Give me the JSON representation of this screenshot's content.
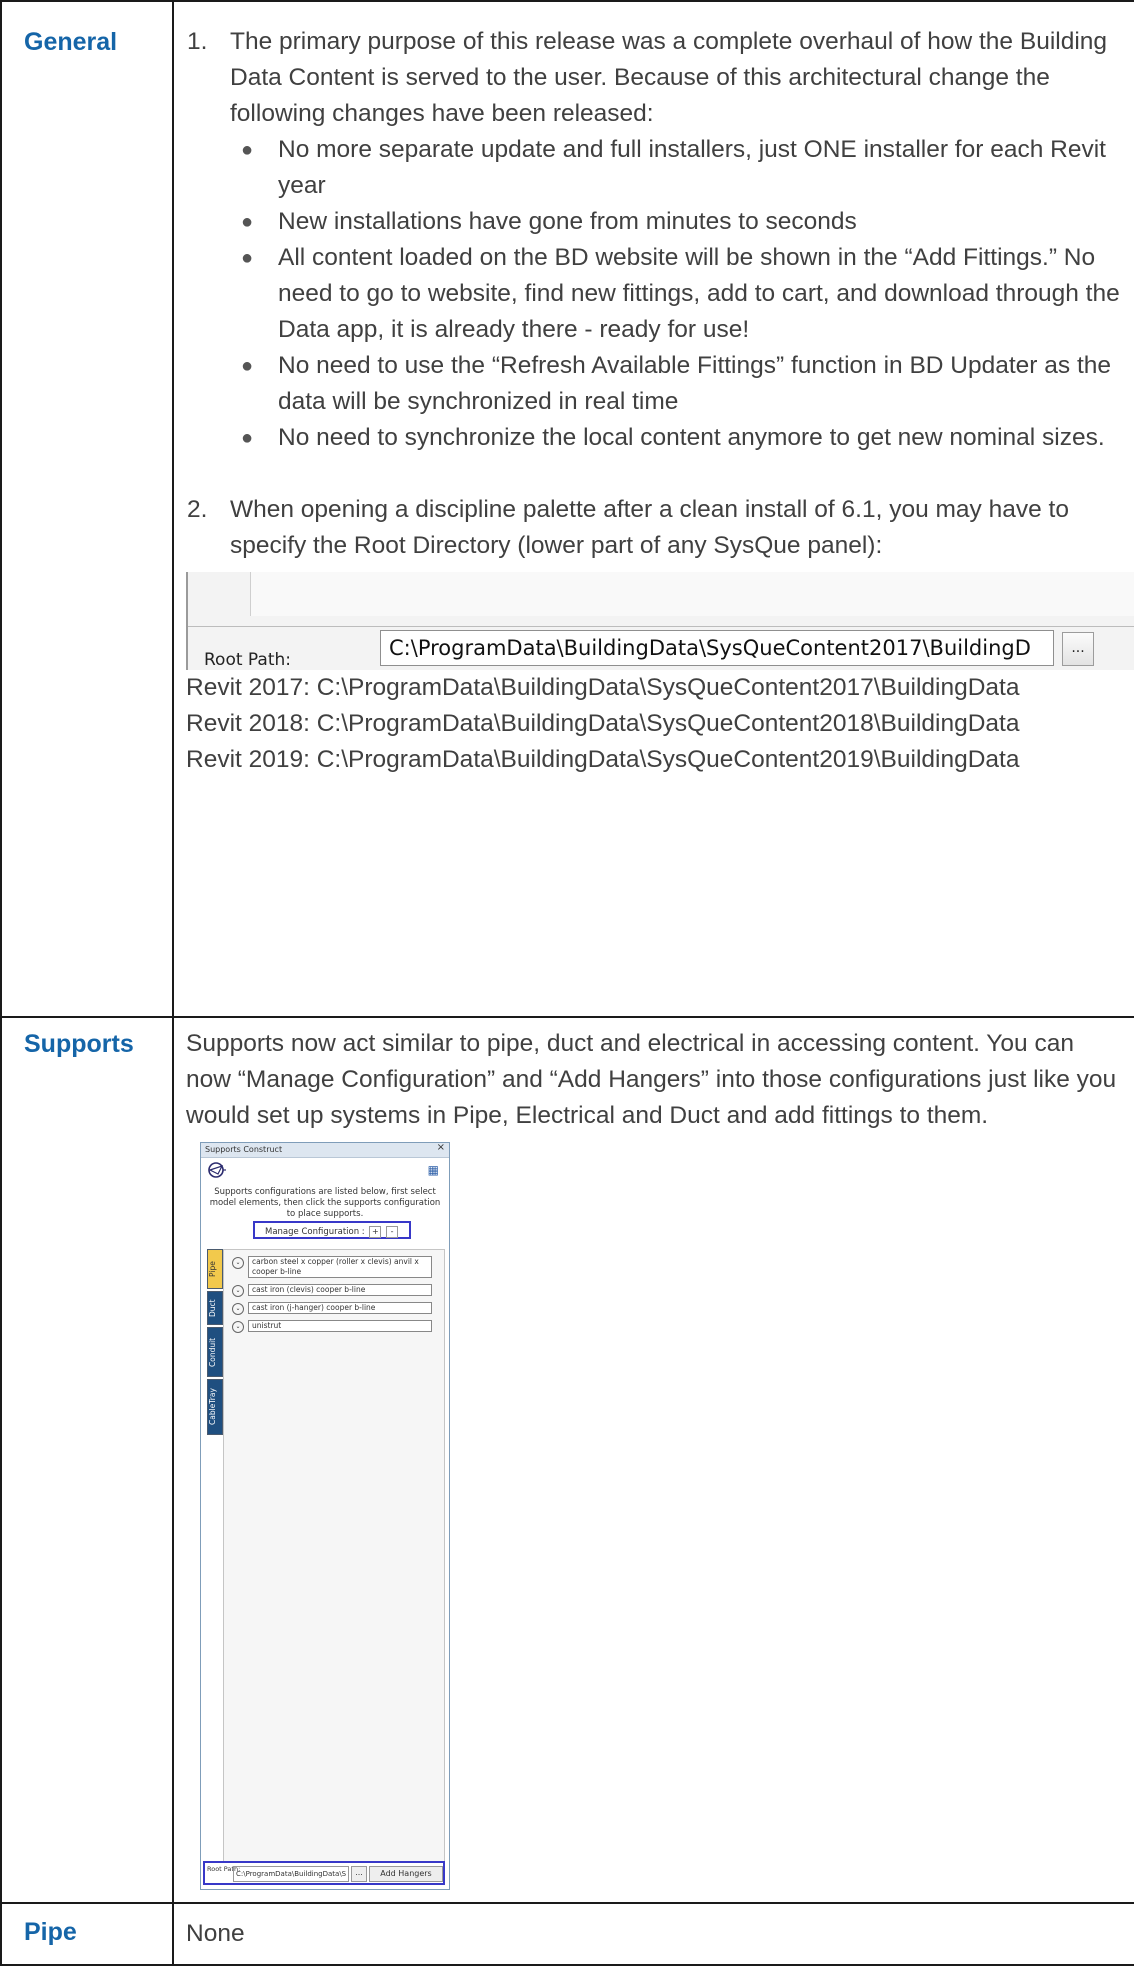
{
  "rows": {
    "general": {
      "label": "General",
      "item1": {
        "number": "1.",
        "text": "The primary purpose of this release was a complete overhaul of how the Building Data Content is served to the user.  Because of this architectural change the following changes have been released:",
        "bullets": [
          "No more separate update and full installers, just ONE installer for each Revit year",
          "New installations have gone from minutes to seconds",
          "All content loaded on the BD website will be shown in the “Add Fittings.”  No need to go to website, find new fittings, add to cart, and download through the Data app, it is already there - ready for use!",
          "No need to use the “Refresh Available Fittings” function in BD Updater as the data will be synchronized in real time",
          "No need to synchronize the local content anymore to get new nominal sizes."
        ]
      },
      "item2": {
        "number": "2.",
        "text": "When opening a discipline palette after a clean install of 6.1, you may have to specify the Root Directory (lower part of any SysQue panel):"
      },
      "root_path_ui": {
        "label": "Root Path:",
        "value": "C:\\ProgramData\\BuildingData\\SysQueContent2017\\BuildingD",
        "browse": "..."
      },
      "paths": [
        "Revit 2017:  C:\\ProgramData\\BuildingData\\SysQueContent2017\\BuildingData",
        "Revit 2018:  C:\\ProgramData\\BuildingData\\SysQueContent2018\\BuildingData",
        "Revit 2019:  C:\\ProgramData\\BuildingData\\SysQueContent2019\\BuildingData"
      ]
    },
    "supports": {
      "label": "Supports",
      "text": "Supports now act similar to pipe, duct and electrical in accessing content.  You can now “Manage Configuration” and “Add Hangers” into those configurations just like you would set up systems in Pipe, Electrical and Duct and add fittings to them.",
      "panel": {
        "title": "Supports Construct",
        "close": "×",
        "grid_icon": "grid-icon",
        "description": "Supports configurations are listed below, first select model elements, then click the supports configuration to place supports.",
        "manage_label": "Manage Configuration :",
        "plus": "+",
        "minus": "-",
        "tabs": [
          "Pipe",
          "Duct",
          "Conduit",
          "CableTray"
        ],
        "configs": [
          "carbon steel x copper (roller x clevis) anvil x cooper b-line",
          "cast iron (clevis) cooper b-line",
          "cast iron (j-hanger) cooper b-line",
          "unistrut"
        ],
        "footer": {
          "label": "Root Path:",
          "value": "C:\\ProgramData\\BuildingData\\S",
          "browse": "...",
          "add": "Add Hangers"
        }
      }
    },
    "pipe": {
      "label": "Pipe",
      "text": "None"
    }
  },
  "colors": {
    "label": "#1565a8",
    "border": "#1a1a1a",
    "highlight": "#3838c8"
  }
}
